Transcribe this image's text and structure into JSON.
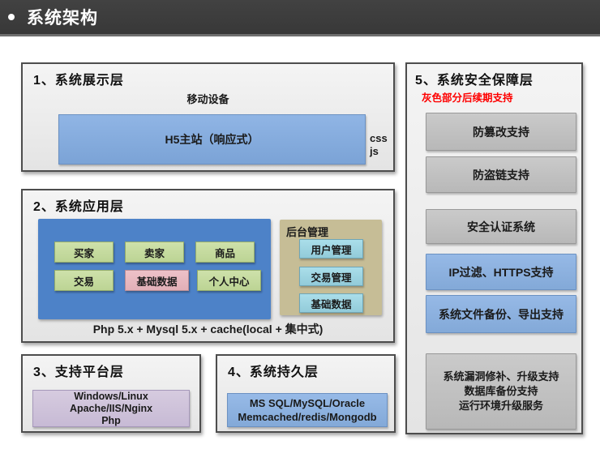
{
  "header": {
    "title": "系统架构"
  },
  "colors": {
    "header_bg": "#3c3c3c",
    "layer_bg": "#ececec",
    "accent_blue": "#4d82c8",
    "light_blue": "#8db4e2",
    "green": "#c3d69b",
    "pink": "#e6b9c0",
    "tan": "#c6bd96",
    "cyan": "#9fd5e2",
    "lavender": "#ccc1d9",
    "gray_item": "#c2c2c2",
    "note_red": "#fe0000"
  },
  "sections": {
    "display": {
      "title": "1、系统展示层",
      "device_label": "移动设备",
      "h5_label": "H5主站（响应式）",
      "side_note_line1": "css",
      "side_note_line2": "js"
    },
    "application": {
      "title": "2、系统应用层",
      "modules": [
        {
          "label": "买家",
          "variant": "green"
        },
        {
          "label": "卖家",
          "variant": "green"
        },
        {
          "label": "商品",
          "variant": "green"
        },
        {
          "label": "交易",
          "variant": "green"
        },
        {
          "label": "基础数据",
          "variant": "pink"
        },
        {
          "label": "个人中心",
          "variant": "green"
        }
      ],
      "admin": {
        "title": "后台管理",
        "items": [
          "用户管理",
          "交易管理",
          "基础数据"
        ]
      },
      "stack_note": "Php 5.x + Mysql 5.x + cache(local + 集中式)"
    },
    "platform": {
      "title": "3、支持平台层",
      "lines": [
        "Windows/Linux",
        "Apache/IIS/Nginx",
        "Php"
      ]
    },
    "persistence": {
      "title": "4、系统持久层",
      "lines": [
        "MS SQL/MySQL/Oracle",
        "Memcached/redis/Mongodb"
      ]
    },
    "security": {
      "title": "5、系统安全保障层",
      "note": "灰色部分后续期支持",
      "items": [
        {
          "label": "防篡改支持",
          "variant": "gray"
        },
        {
          "label": "防盗链支持",
          "variant": "gray"
        },
        {
          "label": "安全认证系统",
          "variant": "gray"
        },
        {
          "label": "IP过滤、HTTPS支持",
          "variant": "blue"
        },
        {
          "label": "系统文件备份、导出支持",
          "variant": "blue"
        }
      ],
      "multi_item_lines": [
        "系统漏洞修补、升级支持",
        "数据库备份支持",
        "运行环境升级服务"
      ]
    }
  }
}
